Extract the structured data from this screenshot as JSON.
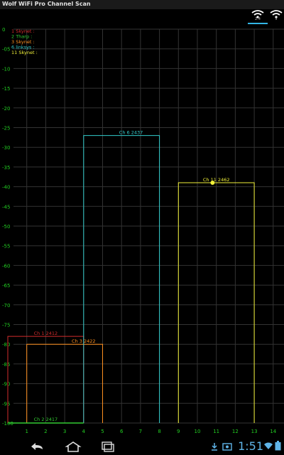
{
  "app": {
    "title": "Wolf WiFi Pro Channel Scan"
  },
  "toolbar": {
    "band_24": "2.4",
    "band_5": "5"
  },
  "legend": [
    {
      "label": "1 Skynet :",
      "color": "#d22c2c"
    },
    {
      "label": "2 Tharp :",
      "color": "#33cc33"
    },
    {
      "label": "3 Skynet :",
      "color": "#ff9020"
    },
    {
      "label": "6 linksys :",
      "color": "#33cccc"
    },
    {
      "label": "11 Skynet :",
      "color": "#f2f23a"
    }
  ],
  "colors": {
    "grid": "#333333",
    "axis_text": "#22cc22"
  },
  "chart_data": {
    "type": "bar",
    "y_ticks": [
      "0",
      "-05",
      "-10",
      "-15",
      "-20",
      "-25",
      "-30",
      "-35",
      "-40",
      "-45",
      "-50",
      "-55",
      "-60",
      "-65",
      "-70",
      "-75",
      "-80",
      "-85",
      "-90",
      "-95",
      "-100"
    ],
    "x_ticks": [
      "1",
      "2",
      "3",
      "4",
      "5",
      "6",
      "7",
      "8",
      "9",
      "10",
      "11",
      "12",
      "13",
      "14"
    ],
    "ylim": [
      -100,
      0
    ],
    "xlim": [
      0.3,
      14.7
    ],
    "grid": true,
    "legend_placement": "top-left",
    "series": [
      {
        "label": "Ch 1  2412",
        "center": 2,
        "start": 0,
        "end": 4,
        "signal": -78,
        "color": "#d22c2c"
      },
      {
        "label": "Ch 3  2422",
        "center": 4,
        "start": 1,
        "end": 5,
        "signal": -80,
        "color": "#ff9020"
      },
      {
        "label": "Ch 6  2437",
        "center": 6.5,
        "start": 4,
        "end": 8,
        "signal": -27,
        "color": "#33cccc"
      },
      {
        "label": "Ch 11  2462",
        "center": 11,
        "start": 9,
        "end": 13,
        "signal": -39,
        "color": "#f2f23a"
      },
      {
        "label": "Ch 2  2417",
        "center": 2,
        "start": 0,
        "end": 4,
        "signal": -100,
        "color": "#33cc33"
      }
    ],
    "marker": {
      "x": 10.8,
      "y": -39,
      "color": "#f2f23a"
    }
  },
  "navbar": {
    "clock": "1:51"
  }
}
